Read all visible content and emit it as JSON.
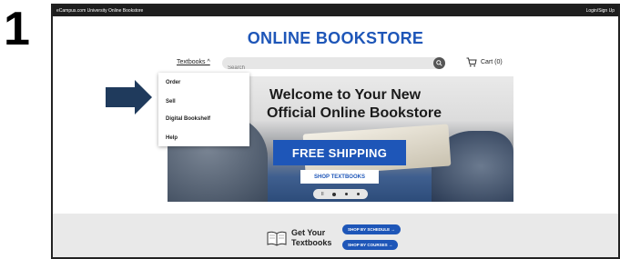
{
  "step_number": "1",
  "topbar": {
    "site_name": "eCampus.com University Online Bookstore",
    "login": "Login/Sign Up"
  },
  "header": {
    "title": "ONLINE BOOKSTORE"
  },
  "nav": {
    "textbooks_label": "Textbooks ^",
    "search_placeholder": "Search",
    "cart_label": "Cart (0)"
  },
  "dropdown": {
    "items": [
      {
        "label": "Order"
      },
      {
        "label": "Sell"
      },
      {
        "label": "Digital Bookshelf"
      },
      {
        "label": "Help"
      }
    ]
  },
  "hero": {
    "line1": "Welcome to Your New",
    "line2": "Official Online Bookstore",
    "free_shipping": "FREE SHIPPING",
    "shop_button": "SHOP TEXTBOOKS",
    "pause_symbol": "II"
  },
  "bottom_banner": {
    "get_line1": "Get Your",
    "get_line2": "Textbooks",
    "shop_by_schedule": "SHOP BY SCHEDULE →",
    "shop_by_courses": "SHOP BY COURSES →"
  },
  "colors": {
    "brand_blue": "#1e56b8",
    "topbar": "#1e1e1e",
    "arrow_fill": "#1f3a5c"
  },
  "icons": [
    "search-icon",
    "cart-icon",
    "book-icon",
    "arrow-pointer-icon"
  ]
}
